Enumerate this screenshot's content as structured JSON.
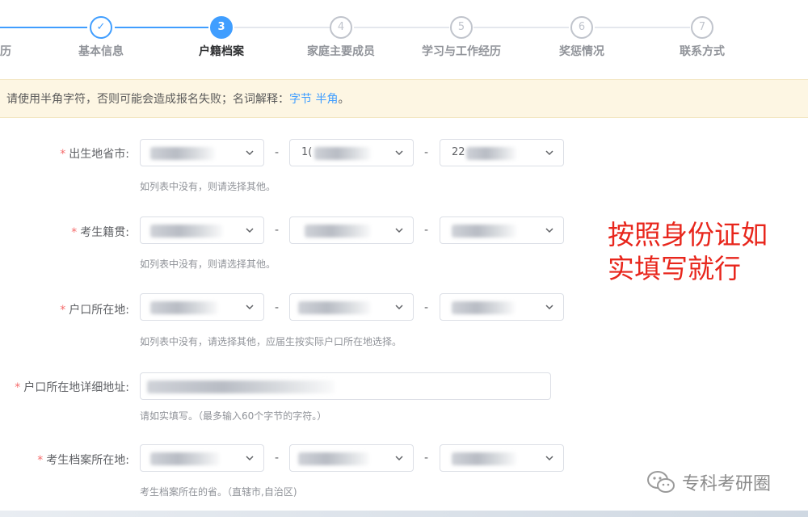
{
  "steps": [
    {
      "index": "",
      "label": "历",
      "state": "done"
    },
    {
      "index": "✓",
      "label": "基本信息",
      "state": "done"
    },
    {
      "index": "3",
      "label": "户籍档案",
      "state": "active"
    },
    {
      "index": "4",
      "label": "家庭主要成员",
      "state": "pending"
    },
    {
      "index": "5",
      "label": "学习与工作经历",
      "state": "pending"
    },
    {
      "index": "6",
      "label": "奖惩情况",
      "state": "pending"
    },
    {
      "index": "7",
      "label": "联系方式",
      "state": "pending"
    }
  ],
  "notice": {
    "text": "请使用半角字符，否则可能会造成报名失败；名词解释：",
    "link_bytes": "字节",
    "link_halfwidth": "半角",
    "suffix": "。"
  },
  "form": {
    "birthplace": {
      "label": "出生地省市:",
      "province_value": "",
      "city_value": "1(",
      "county_value": "22",
      "hint": "如列表中没有，则请选择其他。"
    },
    "native_place": {
      "label": "考生籍贯:",
      "province_value": "",
      "city_value": "",
      "county_value": "",
      "hint": "如列表中没有，则请选择其他。"
    },
    "hukou": {
      "label": "户口所在地:",
      "province_value": "",
      "city_value": "",
      "county_value": "",
      "hint": "如列表中没有，请选择其他，应届生按实际户口所在地选择。"
    },
    "hukou_address": {
      "label": "户口所在地详细地址:",
      "value": "",
      "hint": "请如实填写。（最多输入60个字节的字符。）"
    },
    "archive": {
      "label": "考生档案所在地:",
      "province_value": "",
      "city_value": "",
      "county_value": "",
      "hint": "考生档案所在的省。（直辖市,自治区)"
    },
    "separator": "-",
    "required_mark": "*"
  },
  "annotation": {
    "line1": "按照身份证如",
    "line2": "实填写就行"
  },
  "watermark": {
    "text": "专科考研圈"
  },
  "colors": {
    "primary": "#409eff",
    "required": "#f56c6c",
    "annotation": "#e8261c",
    "notice_bg": "#fdf6e3"
  }
}
